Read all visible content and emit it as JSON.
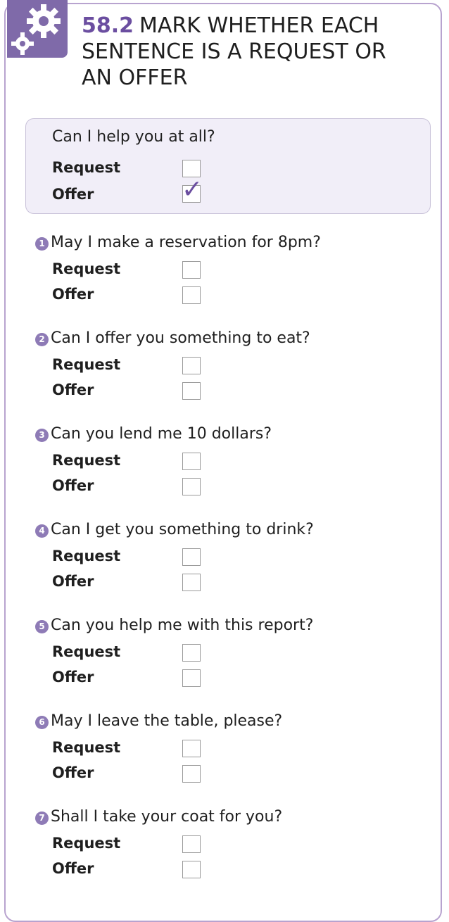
{
  "exercise": {
    "number": "58.2",
    "title": "MARK WHETHER EACH SENTENCE IS A REQUEST OR AN OFFER"
  },
  "example": {
    "question": "Can I help you at all?",
    "request_label": "Request",
    "offer_label": "Offer",
    "checkmark": "✓"
  },
  "items": [
    {
      "num": "1",
      "question": "May I make a reservation for 8pm?",
      "request_label": "Request",
      "offer_label": "Offer"
    },
    {
      "num": "2",
      "question": "Can I offer you something to eat?",
      "request_label": "Request",
      "offer_label": "Offer"
    },
    {
      "num": "3",
      "question": "Can you lend me 10 dollars?",
      "request_label": "Request",
      "offer_label": "Offer"
    },
    {
      "num": "4",
      "question": "Can I get you something to drink?",
      "request_label": "Request",
      "offer_label": "Offer"
    },
    {
      "num": "5",
      "question": "Can you help me with this report?",
      "request_label": "Request",
      "offer_label": "Offer"
    },
    {
      "num": "6",
      "question": "May I leave the table, please?",
      "request_label": "Request",
      "offer_label": "Offer"
    },
    {
      "num": "7",
      "question": "Shall I take your coat for you?",
      "request_label": "Request",
      "offer_label": "Offer"
    }
  ],
  "colors": {
    "accent": "#7f6aa9",
    "example_bg": "#f1eef8",
    "border": "#b8a3cf"
  },
  "icons": {
    "header_icon": "gears-icon"
  }
}
